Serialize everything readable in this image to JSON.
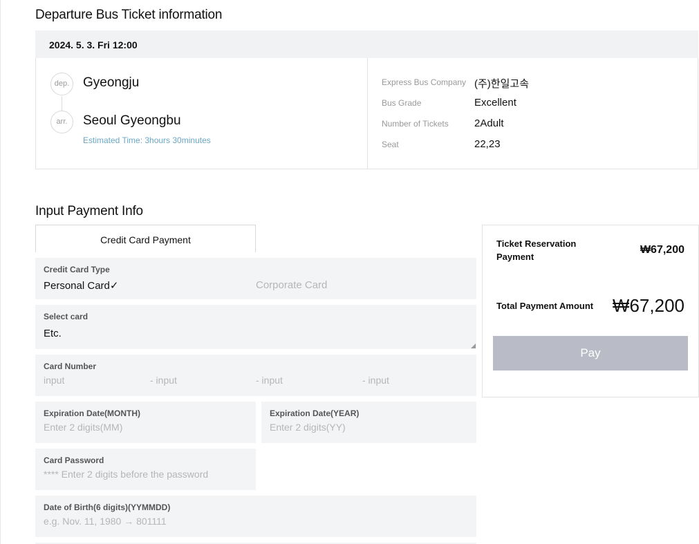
{
  "departure": {
    "title": "Departure Bus Ticket information",
    "datetime": "2024. 5. 3. Fri 12:00",
    "dep_marker": "dep.",
    "dep_city": "Gyeongju",
    "arr_marker": "arr.",
    "arr_city": "Seoul Gyeongbu",
    "estimated": "Estimated Time: 3hours 30minutes",
    "details": [
      {
        "label": "Express Bus Company",
        "value": "(주)한일고속"
      },
      {
        "label": "Bus Grade",
        "value": "Excellent"
      },
      {
        "label": "Number of Tickets",
        "value": "2Adult"
      },
      {
        "label": "Seat",
        "value": "22,23"
      }
    ]
  },
  "payment": {
    "title": "Input Payment Info",
    "tab": "Credit Card Payment",
    "card_type": {
      "label": "Credit Card Type",
      "personal": "Personal Card",
      "check": "✓",
      "corporate": "Corporate Card"
    },
    "select_card": {
      "label": "Select card",
      "value": "Etc."
    },
    "card_number": {
      "label": "Card Number",
      "placeholders": [
        "input",
        "- input",
        "- input",
        "- input"
      ]
    },
    "exp_month": {
      "label": "Expiration Date(MONTH)",
      "placeholder": "Enter 2 digits(MM)"
    },
    "exp_year": {
      "label": "Expiration Date(YEAR)",
      "placeholder": "Enter 2 digits(YY)"
    },
    "card_password": {
      "label": "Card Password",
      "placeholder": "**** Enter 2 digits before the password"
    },
    "birth": {
      "label": "Date of Birth(6 digits)(YYMMDD)",
      "placeholder": "e.g. Nov. 11, 1980 → 801111"
    }
  },
  "summary": {
    "reservation_label_1": "Ticket Reservation",
    "reservation_label_2": "Payment",
    "reservation_amount": "₩67,200",
    "total_label": "Total Payment Amount",
    "total_amount": "₩67,200",
    "pay_button": "Pay"
  }
}
